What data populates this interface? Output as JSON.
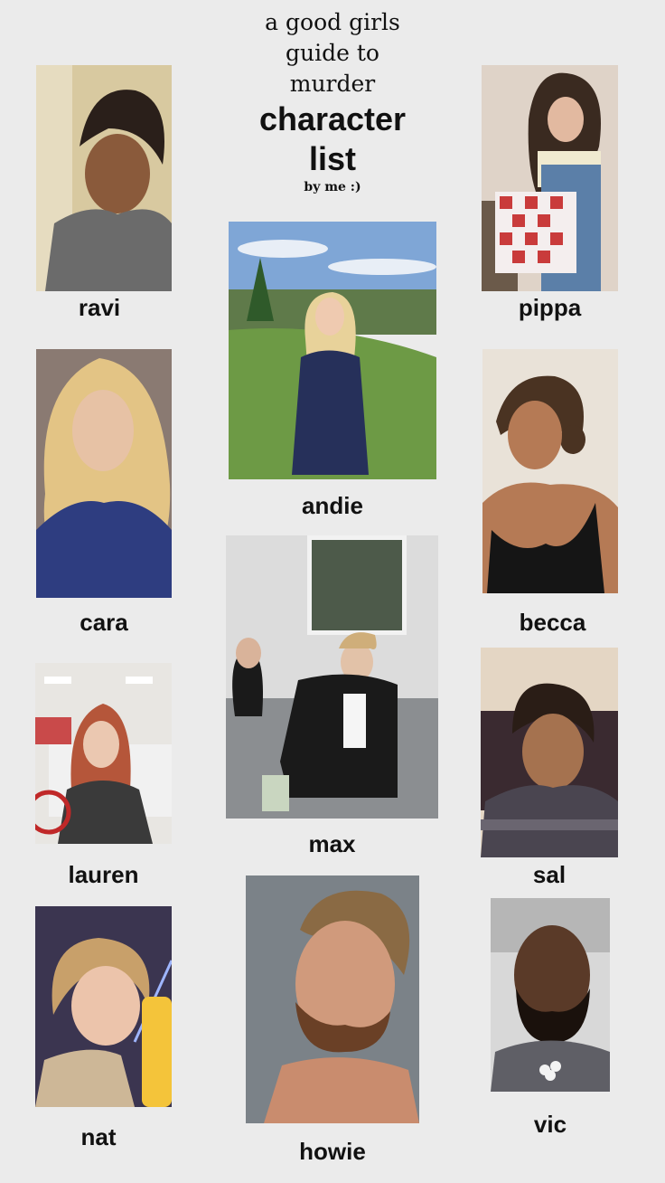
{
  "header": {
    "line1": "a good girls",
    "line2": "guide to",
    "line3": "murder",
    "line4": "character",
    "line5": "list",
    "byline": "by me :)"
  },
  "characters": [
    {
      "name": "ravi"
    },
    {
      "name": "pippa"
    },
    {
      "name": "andie"
    },
    {
      "name": "cara"
    },
    {
      "name": "becca"
    },
    {
      "name": "max"
    },
    {
      "name": "lauren"
    },
    {
      "name": "sal"
    },
    {
      "name": "nat"
    },
    {
      "name": "howie"
    },
    {
      "name": "vic"
    }
  ]
}
